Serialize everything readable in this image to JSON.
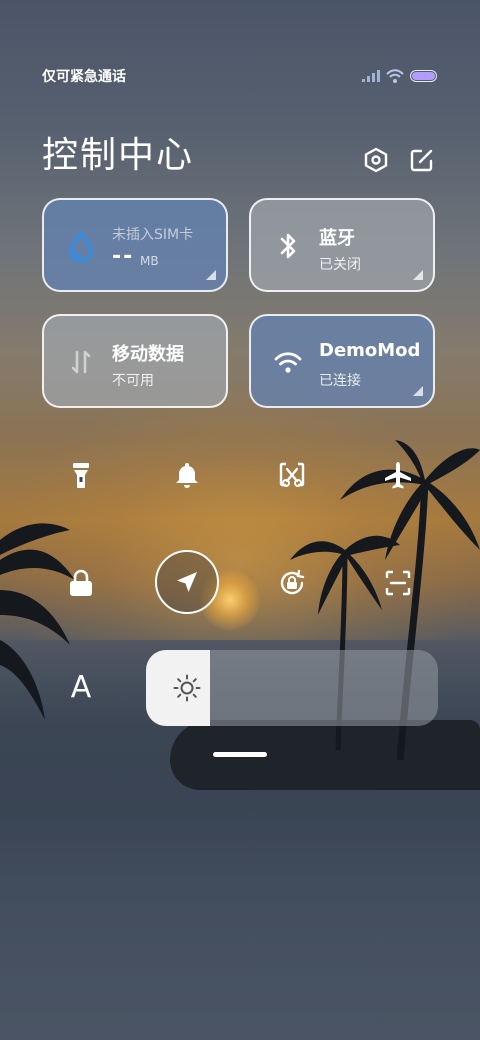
{
  "status_bar": {
    "carrier_text": "仅可紧急通话"
  },
  "header": {
    "title": "控制中心"
  },
  "tiles": {
    "data_usage": {
      "title": "未插入SIM卡",
      "value": "--",
      "unit": "MB",
      "icon": "water-drop-icon",
      "accent": "#2f8fe8"
    },
    "bluetooth": {
      "title": "蓝牙",
      "status": "已关闭",
      "icon": "bluetooth-icon"
    },
    "mobile_data": {
      "title": "移动数据",
      "status": "不可用",
      "icon": "arrows-updown-icon"
    },
    "wifi": {
      "title": "DemoMod",
      "status": "已连接",
      "icon": "wifi-icon"
    }
  },
  "quick_toggles": [
    {
      "icon": "flashlight-icon"
    },
    {
      "icon": "bell-icon"
    },
    {
      "icon": "screenshot-icon"
    },
    {
      "icon": "airplane-icon"
    },
    {
      "icon": "lock-icon"
    },
    {
      "icon": "location-icon"
    },
    {
      "icon": "rotation-lock-icon"
    },
    {
      "icon": "scan-icon"
    }
  ],
  "auto_brightness": {
    "label": "A"
  },
  "brightness": {
    "level": 0.22,
    "icon": "sun-icon"
  }
}
